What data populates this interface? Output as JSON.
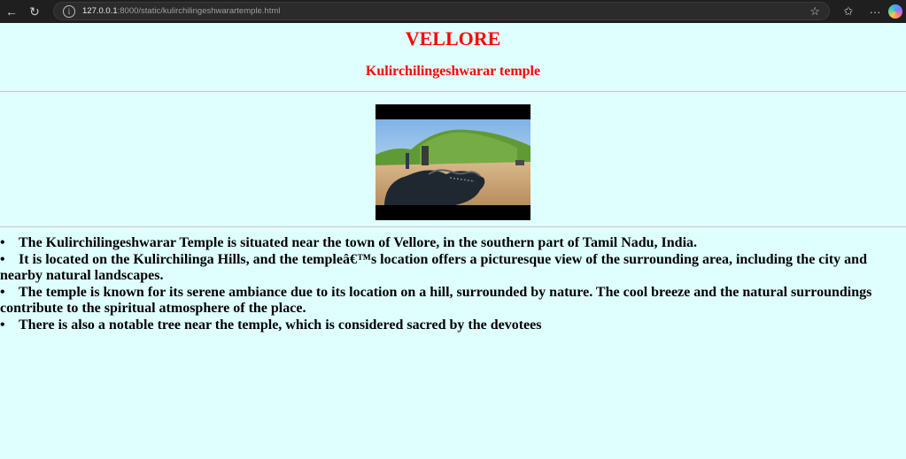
{
  "browser": {
    "url_host": "127.0.0.1",
    "url_rest": ":8000/static/kulirchilingeshwarartemple.html"
  },
  "page": {
    "city": "VELLORE",
    "temple": "Kulirchilingeshwarar temple",
    "facts": [
      "The Kulirchilingeshwarar Temple is situated near the town of Vellore, in the southern part of Tamil Nadu, India.",
      "It is located on the Kulirchilinga Hills, and the templeâ€™s location offers a picturesque view of the surrounding area, including the city and nearby natural landscapes.",
      "The temple is known for its serene ambiance due to its location on a hill, surrounded by nature. The cool breeze and the natural surroundings contribute to the spiritual atmosphere of the place.",
      "There is also a notable tree near the temple, which is considered sacred by the devotees"
    ]
  },
  "colors": {
    "background": "#dfffff",
    "heading": "#ff0000"
  },
  "icons": [
    "back-arrow-icon",
    "reload-icon",
    "info-icon",
    "star-icon",
    "favorites-icon",
    "more-icon",
    "copilot-icon"
  ]
}
